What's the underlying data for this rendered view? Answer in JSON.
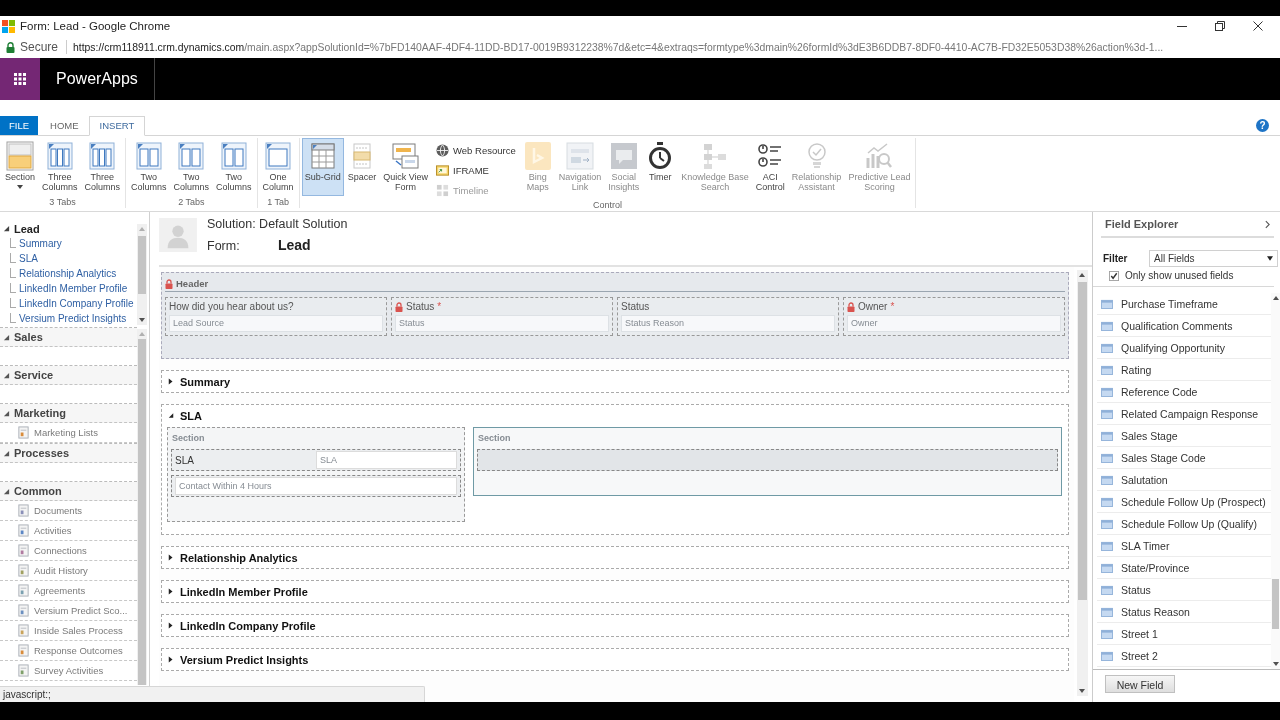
{
  "browser": {
    "title": "Form: Lead - Google Chrome",
    "secure_label": "Secure",
    "url_host": "https://crm118911.crm.dynamics.com",
    "url_rest": "/main.aspx?appSolutionId=%7bFD140AAF-4DF4-11DD-BD17-0019B9312238%7d&etc=4&extraqs=formtype%3dmain%26formId%3dE3B6DDB7-8DF0-4410-AC7B-FD32E5053D38%26action%3d-1..."
  },
  "app_bar": {
    "title": "PowerApps"
  },
  "ribbon": {
    "tabs": [
      {
        "label": "FILE",
        "kind": "file",
        "selected": false
      },
      {
        "label": "HOME",
        "kind": "tab",
        "selected": false
      },
      {
        "label": "INSERT",
        "kind": "tab",
        "selected": true
      }
    ],
    "help": "?",
    "groups": [
      {
        "label": "3 Tabs",
        "buttons": [
          {
            "kind": "large",
            "label": "Section",
            "dropdown": true,
            "selected": false,
            "disabled": false
          },
          {
            "kind": "large",
            "label": "Three\nColumns",
            "dropdown": false,
            "selected": false,
            "disabled": false
          },
          {
            "kind": "large",
            "label": "Three\nColumns",
            "dropdown": false,
            "selected": false,
            "disabled": false
          }
        ]
      },
      {
        "label": "2 Tabs",
        "buttons": [
          {
            "kind": "large",
            "label": "Two\nColumns",
            "dropdown": false,
            "selected": false,
            "disabled": false
          },
          {
            "kind": "large",
            "label": "Two\nColumns",
            "dropdown": false,
            "selected": false,
            "disabled": false
          },
          {
            "kind": "large",
            "label": "Two\nColumns",
            "dropdown": false,
            "selected": false,
            "disabled": false
          }
        ]
      },
      {
        "label": "1 Tab",
        "buttons": [
          {
            "kind": "large",
            "label": "One\nColumn",
            "dropdown": false,
            "selected": false,
            "disabled": false
          }
        ]
      },
      {
        "label": "Control",
        "buttons": [
          {
            "kind": "large",
            "label": "Sub-Grid",
            "dropdown": false,
            "selected": true,
            "disabled": false
          },
          {
            "kind": "large",
            "label": "Spacer",
            "dropdown": false,
            "selected": false,
            "disabled": false
          },
          {
            "kind": "large",
            "label": "Quick View\nForm",
            "dropdown": false,
            "selected": false,
            "disabled": false
          },
          {
            "kind": "stack",
            "items": [
              {
                "label": "Web Resource",
                "disabled": false
              },
              {
                "label": "IFRAME",
                "disabled": false
              },
              {
                "label": "Timeline",
                "disabled": true
              }
            ]
          },
          {
            "kind": "large",
            "label": "Bing\nMaps",
            "dropdown": false,
            "selected": false,
            "disabled": true
          },
          {
            "kind": "large",
            "label": "Navigation\nLink",
            "dropdown": false,
            "selected": false,
            "disabled": true
          },
          {
            "kind": "large",
            "label": "Social\nInsights",
            "dropdown": false,
            "selected": false,
            "disabled": true
          },
          {
            "kind": "large",
            "label": "Timer",
            "dropdown": false,
            "selected": false,
            "disabled": false
          },
          {
            "kind": "large",
            "label": "Knowledge Base\nSearch",
            "dropdown": false,
            "selected": false,
            "disabled": true
          },
          {
            "kind": "large",
            "label": "ACI\nControl",
            "dropdown": false,
            "selected": false,
            "disabled": false
          },
          {
            "kind": "large",
            "label": "Relationship\nAssistant",
            "dropdown": false,
            "selected": false,
            "disabled": true
          },
          {
            "kind": "large",
            "label": "Predictive Lead\nScoring",
            "dropdown": false,
            "selected": false,
            "disabled": true
          }
        ]
      }
    ]
  },
  "nav": {
    "tree": {
      "label": "Lead",
      "expanded": true,
      "children": [
        {
          "label": "Summary"
        },
        {
          "label": "SLA"
        },
        {
          "label": "Relationship Analytics"
        },
        {
          "label": "LinkedIn Member Profile"
        },
        {
          "label": "LinkedIn Company Profile"
        },
        {
          "label": "Versium Predict Insights"
        }
      ]
    },
    "groups": [
      {
        "label": "Sales",
        "expanded": true
      },
      {
        "label": "Service",
        "expanded": true
      },
      {
        "label": "Marketing",
        "expanded": true,
        "items": [
          "Marketing Lists"
        ]
      },
      {
        "label": "Processes",
        "expanded": true
      },
      {
        "label": "Common",
        "expanded": true,
        "items": [
          "Documents",
          "Activities",
          "Connections",
          "Audit History",
          "Agreements",
          "Versium Predict Sco...",
          "Inside Sales Process",
          "Response Outcomes",
          "Survey Activities"
        ]
      }
    ]
  },
  "form": {
    "solution": "Solution: Default Solution",
    "form_label": "Form:",
    "form_name": "Lead",
    "header": {
      "label": "Header",
      "locked": true,
      "fields": [
        {
          "label": "How did you hear about us?",
          "locked": false,
          "placeholder": "Lead Source"
        },
        {
          "label": "Status",
          "required_mark": "*",
          "locked": true,
          "placeholder": "Status"
        },
        {
          "label": "Status",
          "locked": false,
          "placeholder": "Status Reason"
        },
        {
          "label": "Owner",
          "required_mark": "*",
          "locked": true,
          "placeholder": "Owner"
        }
      ]
    },
    "tabs": [
      {
        "label": "Summary",
        "expanded": false
      },
      {
        "label": "SLA",
        "expanded": true,
        "sections": [
          {
            "label": "Section",
            "selected": false,
            "fields": [
              {
                "kind": "labeled",
                "label": "SLA",
                "placeholder": "SLA"
              },
              {
                "kind": "unlabeled",
                "placeholder": "Contact Within 4 Hours"
              }
            ]
          },
          {
            "label": "Section",
            "selected": true,
            "fields": [
              {
                "kind": "empty"
              }
            ]
          }
        ]
      },
      {
        "label": "Relationship Analytics",
        "expanded": false
      },
      {
        "label": "LinkedIn Member Profile",
        "expanded": false
      },
      {
        "label": "LinkedIn Company Profile",
        "expanded": false
      },
      {
        "label": "Versium Predict Insights",
        "expanded": false
      }
    ]
  },
  "field_explorer": {
    "title": "Field Explorer",
    "filter": {
      "label": "Filter",
      "value": "All Fields"
    },
    "unused_only": {
      "label": "Only show unused fields",
      "checked": true
    },
    "fields": [
      "Purchase Timeframe",
      "Qualification Comments",
      "Qualifying Opportunity",
      "Rating",
      "Reference Code",
      "Related Campaign Response",
      "Sales Stage",
      "Sales Stage Code",
      "Salutation",
      "Schedule Follow Up (Prospect)",
      "Schedule Follow Up (Qualify)",
      "SLA Timer",
      "State/Province",
      "Status",
      "Status Reason",
      "Street 1",
      "Street 2"
    ],
    "new_field_button": "New Field"
  },
  "status_bar": {
    "text": "javascript:;"
  }
}
